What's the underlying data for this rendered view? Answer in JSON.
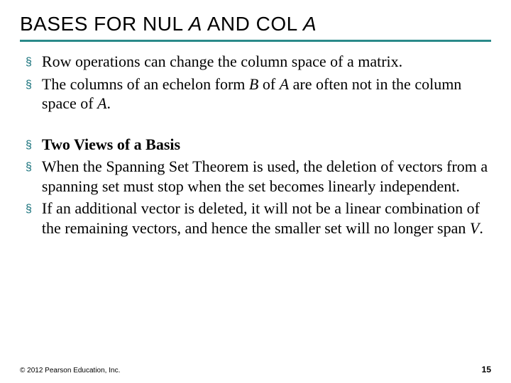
{
  "title": {
    "pre": "BASES FOR NUL ",
    "a1": "A",
    "mid": " AND COL ",
    "a2": "A"
  },
  "bullets_top": [
    {
      "html": "Row operations can change the column space of a matrix."
    },
    {
      "html": "The columns of an echelon form <span class='ital'>B</span> of <span class='ital'>A</span> are often not in the column space of <span class='ital'>A</span>."
    }
  ],
  "bullets_bottom": [
    {
      "html": "<span class='bold'>Two Views of a Basis</span>"
    },
    {
      "html": "When the Spanning Set Theorem is used, the deletion of vectors from a spanning set must stop when the set becomes linearly independent."
    },
    {
      "html": "If an additional vector is deleted, it will not be a linear combination of the remaining vectors, and hence the smaller set will no longer span <span class='ital'>V</span>."
    }
  ],
  "footer": {
    "copyright": "© 2012 Pearson Education, Inc.",
    "page": "15"
  }
}
